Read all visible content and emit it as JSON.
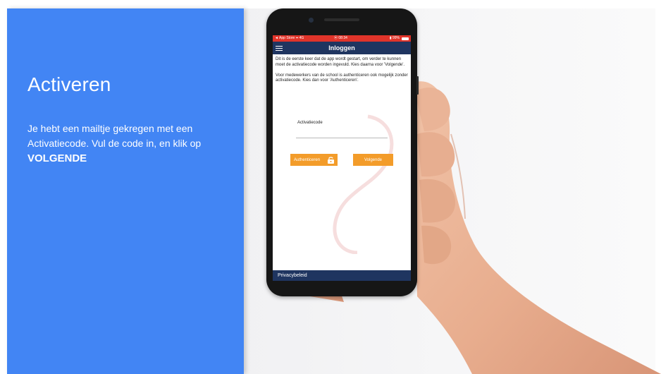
{
  "slide": {
    "title": "Activeren",
    "body_text": "Je hebt een mailtje gekregen met een Activatiecode. Vul de code in, en klik op ",
    "body_emphasis": "VOLGENDE",
    "panel_color": "#4285f4"
  },
  "phone": {
    "status_bar": {
      "left": "◄ App Store ▪▪ 4G",
      "time": "⦿ 08:34",
      "battery": "▮ 99%"
    },
    "app_bar": {
      "menu_icon": "hamburger-icon",
      "title": "Inloggen"
    },
    "content": {
      "paragraph_1": "Dit is de eerste keer dat de app wordt gestart, om verder te kunnen moet de activatiecode worden ingevuld. Kies daarna voor 'Volgende'.",
      "paragraph_2": "Voor medewerkers van de school is authenticeren ook mogelijk zonder activatiecode. Kies dan voor 'Authenticeren'."
    },
    "form": {
      "activation_label": "Activatiecode",
      "activation_value": "",
      "auth_button": "Authenticeren",
      "auth_icon": "lock-icon",
      "next_button": "Volgende"
    },
    "footer": {
      "privacy_link": "Privacybeleid"
    },
    "colors": {
      "accent": "#f39c2a",
      "app_bar": "#1f3560",
      "status_bar": "#e0342a"
    }
  }
}
